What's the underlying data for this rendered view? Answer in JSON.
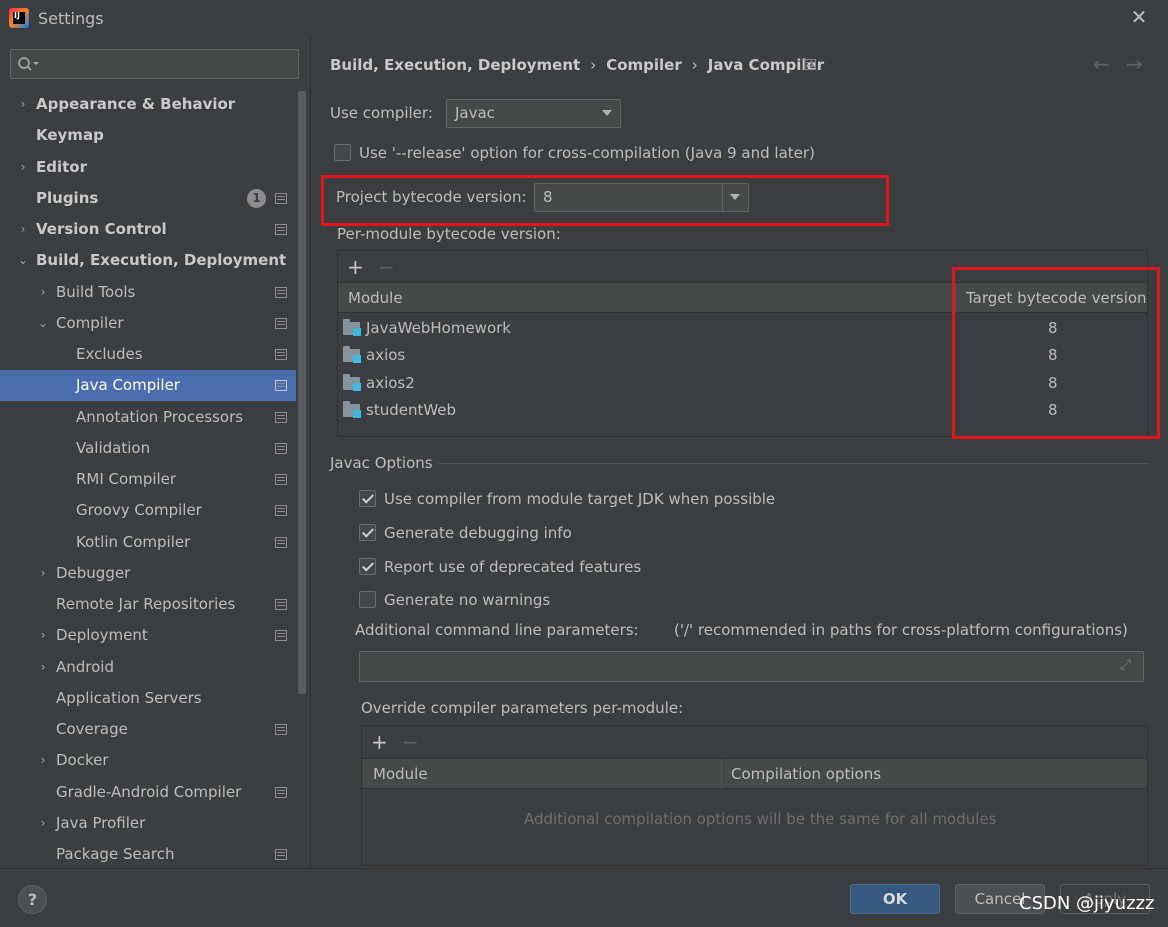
{
  "window": {
    "title": "Settings",
    "close_glyph": "✕"
  },
  "search": {
    "value": "",
    "placeholder": ""
  },
  "sidebar": {
    "items": [
      {
        "label": "Appearance & Behavior",
        "bold": true
      },
      {
        "label": "Keymap",
        "bold": true
      },
      {
        "label": "Editor",
        "bold": true
      },
      {
        "label": "Plugins",
        "bold": true,
        "badge": "1"
      },
      {
        "label": "Version Control",
        "bold": true
      },
      {
        "label": "Build, Execution, Deployment",
        "bold": true
      },
      {
        "label": "Build Tools"
      },
      {
        "label": "Compiler"
      },
      {
        "label": "Excludes"
      },
      {
        "label": "Java Compiler",
        "selected": true
      },
      {
        "label": "Annotation Processors"
      },
      {
        "label": "Validation"
      },
      {
        "label": "RMI Compiler"
      },
      {
        "label": "Groovy Compiler"
      },
      {
        "label": "Kotlin Compiler"
      },
      {
        "label": "Debugger"
      },
      {
        "label": "Remote Jar Repositories"
      },
      {
        "label": "Deployment"
      },
      {
        "label": "Android"
      },
      {
        "label": "Application Servers"
      },
      {
        "label": "Coverage"
      },
      {
        "label": "Docker"
      },
      {
        "label": "Gradle-Android Compiler"
      },
      {
        "label": "Java Profiler"
      },
      {
        "label": "Package Search"
      }
    ]
  },
  "breadcrumb": {
    "parts": [
      "Build, Execution, Deployment",
      "Compiler",
      "Java Compiler"
    ],
    "separator": "›",
    "back_glyph": "←",
    "forward_glyph": "→"
  },
  "compiler": {
    "use_compiler_label": "Use compiler:",
    "use_compiler_value": "Javac",
    "release_option_label": "Use '--release' option for cross-compilation (Java 9 and later)",
    "release_option_checked": false,
    "project_bytecode_label": "Project bytecode version:",
    "project_bytecode_value": "8",
    "per_module_label": "Per-module bytecode version:",
    "module_table": {
      "plus": "+",
      "minus": "−",
      "columns": [
        "Module",
        "Target bytecode version"
      ],
      "rows": [
        {
          "module": "JavaWebHomework",
          "version": "8"
        },
        {
          "module": "axios",
          "version": "8"
        },
        {
          "module": "axios2",
          "version": "8"
        },
        {
          "module": "studentWeb",
          "version": "8"
        }
      ]
    }
  },
  "javac": {
    "section_title": "Javac Options",
    "options": [
      {
        "label": "Use compiler from module target JDK when possible",
        "checked": true
      },
      {
        "label": "Generate debugging info",
        "checked": true
      },
      {
        "label": "Report use of deprecated features",
        "checked": true
      },
      {
        "label": "Generate no warnings",
        "checked": false
      }
    ],
    "cmdline_label": "Additional command line parameters:",
    "cmdline_hint": "('/' recommended in paths for cross-platform configurations)",
    "cmdline_value": "",
    "override_label": "Override compiler parameters per-module:",
    "override_table": {
      "plus": "+",
      "minus": "−",
      "columns": [
        "Module",
        "Compilation options"
      ],
      "empty_text": "Additional compilation options will be the same for all modules"
    }
  },
  "buttons": {
    "ok": "OK",
    "cancel": "Cancel",
    "apply": "Apply",
    "help": "?"
  },
  "watermark": "CSDN @jiyuzzz",
  "colors": {
    "accent": "#4b6eaf",
    "highlight": "#e3141b",
    "ok_button": "#365880"
  }
}
